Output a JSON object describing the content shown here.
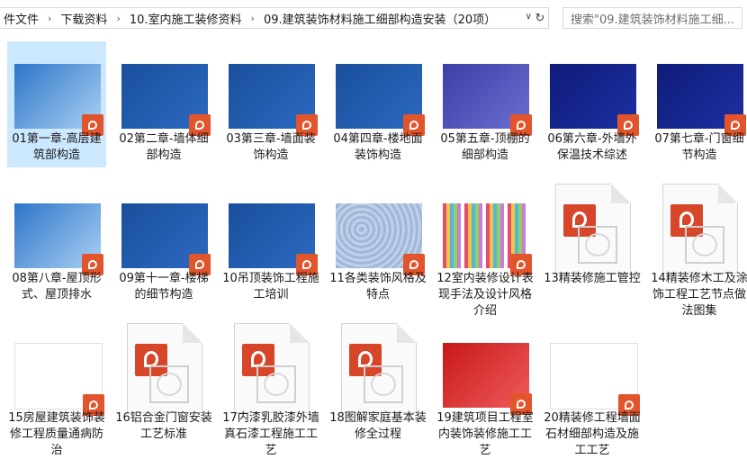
{
  "breadcrumb": [
    "件文件",
    "下载资料",
    "10.室内施工装修资料",
    "09.建筑装饰材料施工细部构造安装（20项）"
  ],
  "search": {
    "placeholder": "搜索\"09.建筑装饰材料施工细..."
  },
  "files": [
    {
      "name": "01第一章-高层建筑部构造",
      "thumb": "blue-light",
      "selected": true
    },
    {
      "name": "02第二章-墙体细部构造",
      "thumb": "blue"
    },
    {
      "name": "03第三章-墙面装饰构造",
      "thumb": "blue"
    },
    {
      "name": "04第四章-楼地面装饰构造",
      "thumb": "blue"
    },
    {
      "name": "05第五章-顶棚的细部构造",
      "thumb": "purple"
    },
    {
      "name": "06第六章-外墙外保温技术综述",
      "thumb": "navy"
    },
    {
      "name": "07第七章-门窗细节构造",
      "thumb": "navy"
    },
    {
      "name": "08第八章-屋顶形式、屋顶排水",
      "thumb": "blue-light"
    },
    {
      "name": "09第十一章-楼梯的细节构造",
      "thumb": "blue"
    },
    {
      "name": "10吊顶装饰工程施工培训",
      "thumb": "blue"
    },
    {
      "name": "11各类装饰风格及特点",
      "thumb": "map"
    },
    {
      "name": "12室内装修设计表现手法及设计风格介绍",
      "thumb": "stripes"
    },
    {
      "name": "13精装修施工管控",
      "thumb": "doc"
    },
    {
      "name": "14精装修木工及涂饰工程工艺节点做法图集",
      "thumb": "doc"
    },
    {
      "name": "15房屋建筑装饰装修工程质量通病防治",
      "thumb": "white"
    },
    {
      "name": "16铝合金门窗安装工艺标准",
      "thumb": "doc"
    },
    {
      "name": "17内漆乳胶漆外墙真石漆工程施工工艺",
      "thumb": "doc"
    },
    {
      "name": "18图解家庭基本装修全过程",
      "thumb": "doc"
    },
    {
      "name": "19建筑项目工程室内装饰装修施工工艺",
      "thumb": "red"
    },
    {
      "name": "20精装修工程墙面石材细部构造及施工工艺",
      "thumb": "green"
    }
  ],
  "colors": {
    "selection": "#cce8ff",
    "ppt_badge": "#e2542c"
  }
}
